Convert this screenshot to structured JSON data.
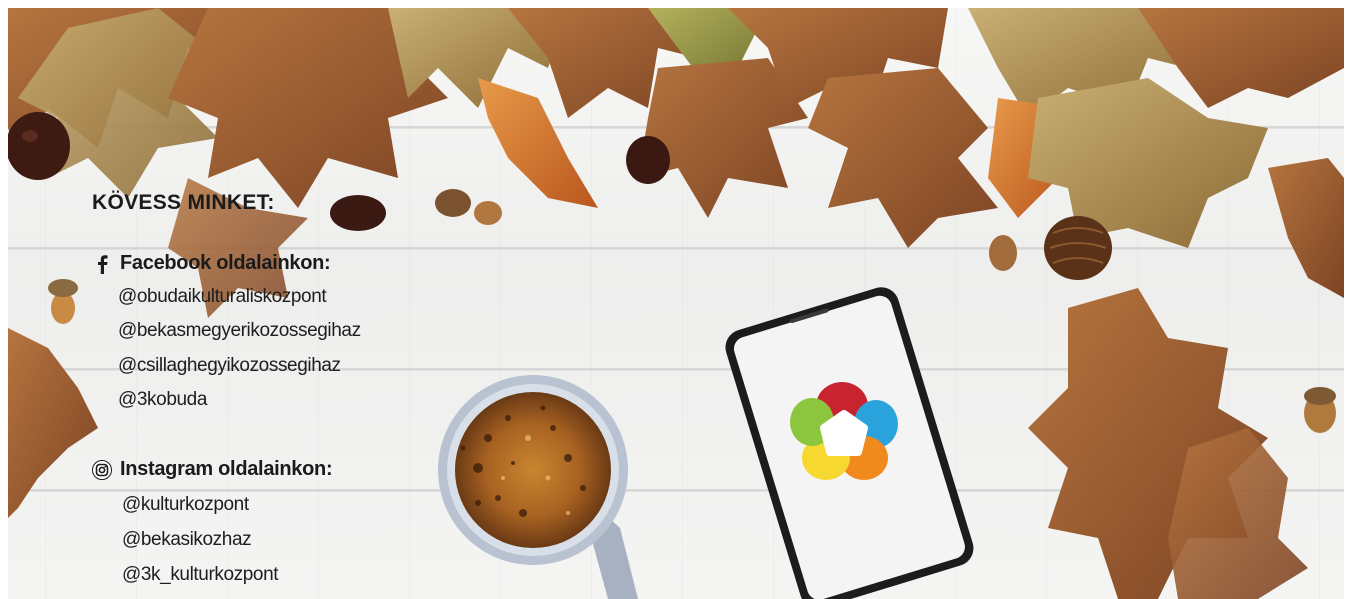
{
  "heading": "KÖVESS MINKET:",
  "facebook": {
    "icon": "facebook-icon",
    "title": "Facebook oldalainkon:",
    "handles": [
      "@obudaikulturaliskozpont",
      "@bekasmegyerikozossegihaz",
      "@csillaghegyikozossegihaz",
      "@3kobuda"
    ]
  },
  "instagram": {
    "icon": "instagram-icon",
    "title": "Instagram oldalainkon:",
    "handles": [
      "@kulturkozpont",
      "@bekasikozhaz",
      "@3k_kulturkozpont"
    ]
  },
  "colors": {
    "text": "#1b1b1b",
    "leaf_brown": "#9a5a2e",
    "leaf_orange": "#d9772a",
    "leaf_green": "#9a9a45",
    "logo_red": "#c8242f",
    "logo_blue": "#2aa3dd",
    "logo_orange": "#f08a1c",
    "logo_yellow": "#f7d830",
    "logo_green": "#8cc63f"
  }
}
